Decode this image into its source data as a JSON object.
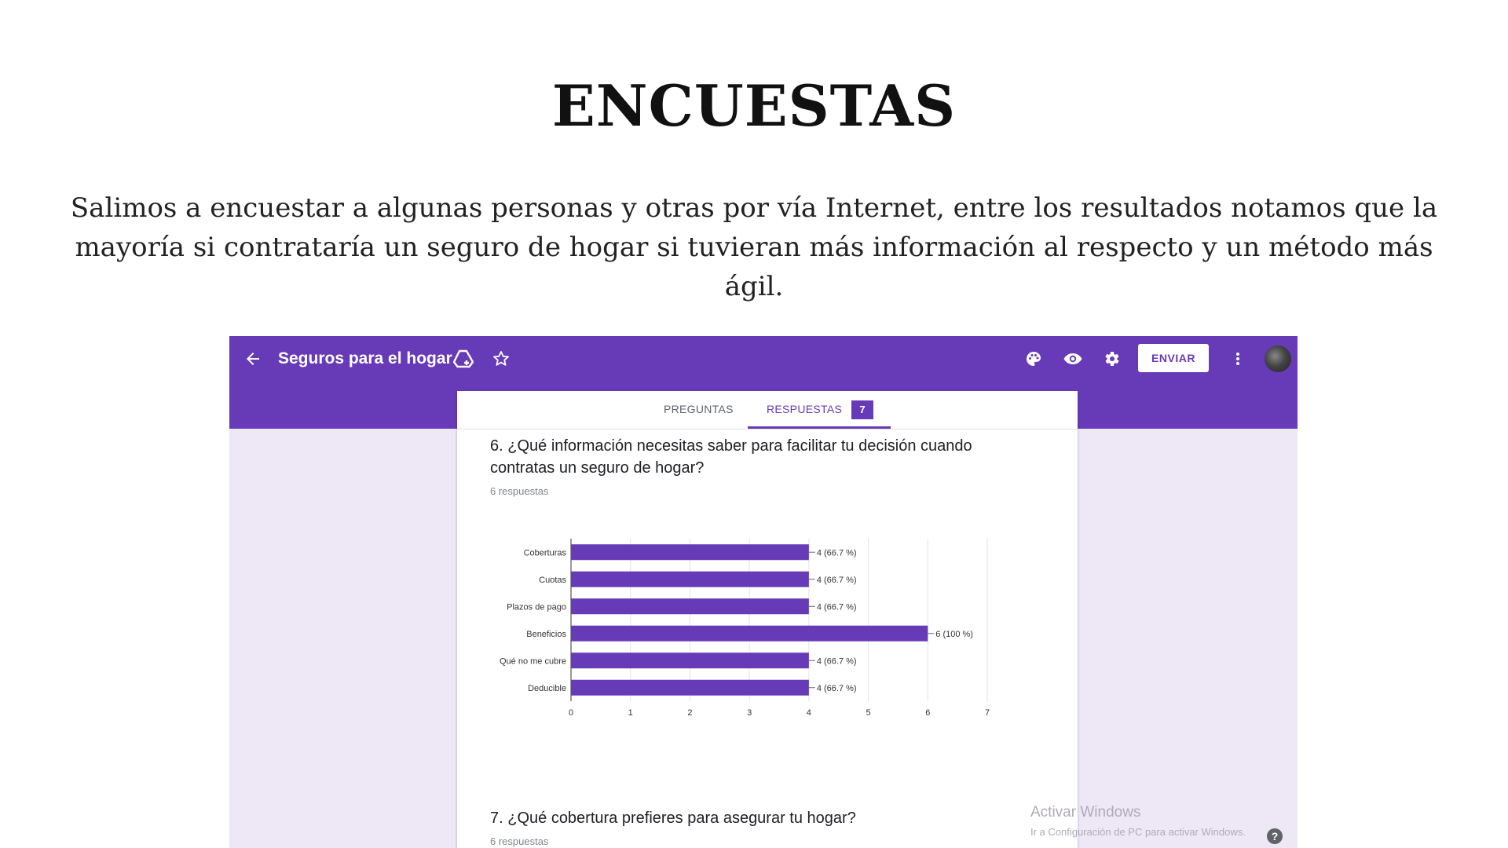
{
  "slide": {
    "title": "ENCUESTAS",
    "paragraph": "Salimos a encuestar a algunas personas y otras por vía Internet, entre los resultados notamos que la mayoría si contrataría un seguro de hogar si tuvieran más información al respecto y un método más ágil."
  },
  "forms": {
    "accent_color": "#673ab7",
    "header": {
      "title": "Seguros para el hogar",
      "send_label": "ENVIAR",
      "icons": [
        "back-arrow-icon",
        "drive-icon",
        "star-icon",
        "palette-icon",
        "eye-icon",
        "gear-icon",
        "more-vert-icon",
        "avatar"
      ]
    },
    "tabs": {
      "questions": "PREGUNTAS",
      "responses": "RESPUESTAS",
      "responses_count": "7"
    },
    "question6": {
      "title": "6. ¿Qué información necesitas saber para facilitar tu decisión cuando contratas un seguro de hogar?",
      "responses": "6 respuestas"
    },
    "question7": {
      "title": "7. ¿Qué cobertura prefieres para asegurar tu hogar?",
      "responses": "6 respuestas"
    },
    "watermark": {
      "line1": "Activar Windows",
      "line2": "Ir a Configuración de PC para activar Windows."
    }
  },
  "chart_data": {
    "type": "bar",
    "orientation": "horizontal",
    "categories": [
      "Coberturas",
      "Cuotas",
      "Plazos de pago",
      "Beneficios",
      "Qué no me cubre",
      "Deducible"
    ],
    "values": [
      4,
      4,
      4,
      6,
      4,
      4
    ],
    "data_labels": [
      "4 (66.7 %)",
      "4 (66.7 %)",
      "4 (66.7 %)",
      "6 (100 %)",
      "4 (66.7 %)",
      "4 (66.7 %)"
    ],
    "xlim": [
      0,
      7
    ],
    "xticks": [
      "0",
      "1",
      "2",
      "3",
      "4",
      "5",
      "6",
      "7"
    ],
    "grid": true,
    "bar_color": "#673ab7"
  }
}
